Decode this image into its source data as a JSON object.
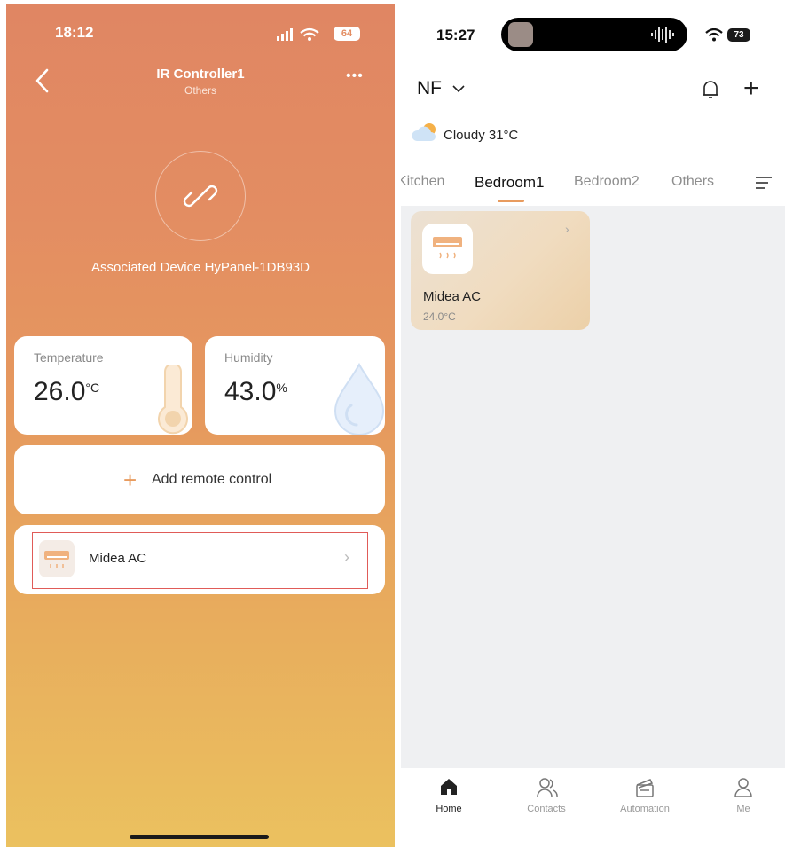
{
  "left_screen": {
    "status_time": "18:12",
    "battery": "64",
    "header": {
      "title": "IR Controller1",
      "subtitle": "Others"
    },
    "associated_device": "Associated Device HyPanel-1DB93D",
    "sensors": [
      {
        "label": "Temperature",
        "value": "26.0",
        "unit": "°C",
        "icon": "thermometer-icon"
      },
      {
        "label": "Humidity",
        "value": "43.0",
        "unit": "%",
        "icon": "water-drop-icon"
      }
    ],
    "add_remote_label": "Add remote control",
    "remote_device": {
      "name": "Midea AC",
      "icon": "air-conditioner-icon"
    },
    "colors": {
      "gradient_top": "#e08663",
      "gradient_bottom": "#ebc15f",
      "accent": "#e89b5e",
      "highlight_border": "#e05b58"
    }
  },
  "right_screen": {
    "status_time": "15:27",
    "battery": "73",
    "home_name": "NF",
    "weather": {
      "condition": "Cloudy 31°C",
      "icon": "cloudy-icon"
    },
    "room_tabs": [
      {
        "label": "Kitchen",
        "active": false
      },
      {
        "label": "Bedroom1",
        "active": true
      },
      {
        "label": "Bedroom2",
        "active": false
      },
      {
        "label": "Others",
        "active": false
      }
    ],
    "device_tile": {
      "name": "Midea AC",
      "temperature": "24.0°C",
      "icon": "air-conditioner-icon"
    },
    "nav": [
      {
        "label": "Home",
        "icon": "home-icon",
        "active": true
      },
      {
        "label": "Contacts",
        "icon": "contacts-icon",
        "active": false
      },
      {
        "label": "Automation",
        "icon": "automation-icon",
        "active": false
      },
      {
        "label": "Me",
        "icon": "profile-icon",
        "active": false
      }
    ],
    "colors": {
      "content_bg": "#eff0f2",
      "tab_indicator": "#e89b5e"
    }
  }
}
